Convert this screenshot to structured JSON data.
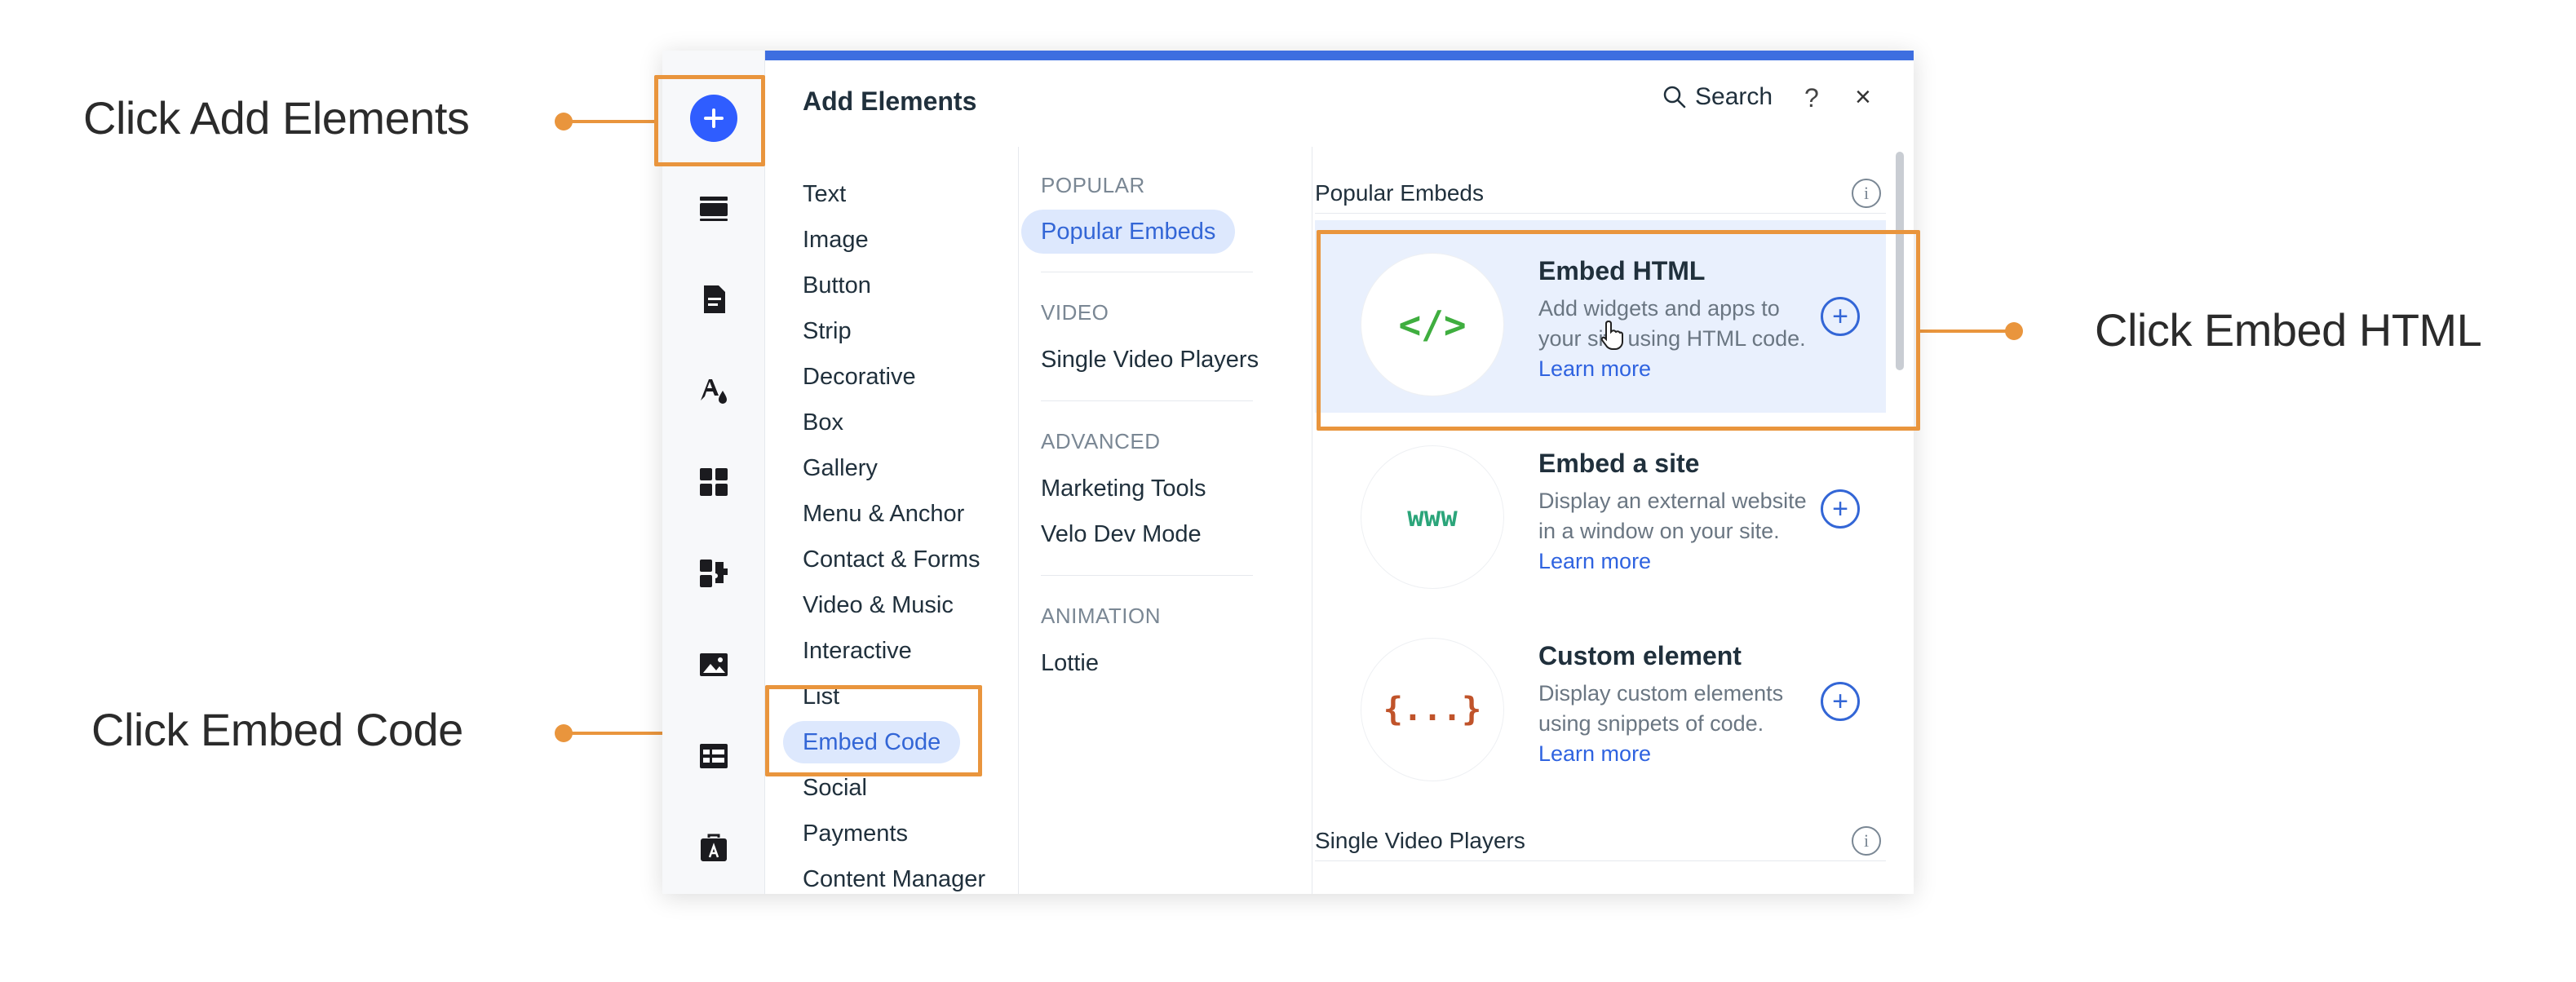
{
  "annotations": {
    "add_elements": "Click Add Elements",
    "embed_html": "Click Embed HTML",
    "embed_code": "Click Embed Code"
  },
  "panel": {
    "title": "Add Elements",
    "search_label": "Search",
    "help_label": "?",
    "close_label": "×"
  },
  "categories": [
    "Text",
    "Image",
    "Button",
    "Strip",
    "Decorative",
    "Box",
    "Gallery",
    "Menu & Anchor",
    "Contact & Forms",
    "Video & Music",
    "Interactive",
    "List",
    "Embed Code",
    "Social",
    "Payments",
    "Content Manager"
  ],
  "selected_category": "Embed Code",
  "subcategories": {
    "popular_label": "POPULAR",
    "popular_item": "Popular Embeds",
    "video_label": "VIDEO",
    "video_item": "Single Video Players",
    "advanced_label": "ADVANCED",
    "advanced_items": [
      "Marketing Tools",
      "Velo Dev Mode"
    ],
    "animation_label": "ANIMATION",
    "animation_item": "Lottie"
  },
  "content": {
    "section1_title": "Popular Embeds",
    "section2_title": "Single Video Players",
    "info_glyph": "i",
    "add_glyph": "+",
    "cards": [
      {
        "thumb": "</>",
        "title": "Embed HTML",
        "desc": "Add widgets and apps to your site using HTML code.",
        "link": "Learn more",
        "thumb_color": "#3fae3f"
      },
      {
        "thumb": "www",
        "title": "Embed a site",
        "desc": "Display an external website in a window on your site.",
        "link": "Learn more",
        "thumb_color": "#2ba57a"
      },
      {
        "thumb": "{...}",
        "title": "Custom element",
        "desc": "Display custom elements using snippets of code.",
        "link": "Learn more",
        "thumb_color": "#c0532a"
      }
    ]
  },
  "colors": {
    "accent": "#3366d6",
    "highlight": "#e9953d",
    "topbar": "#3d6ee0"
  },
  "rail_icons": [
    "add-icon",
    "strip-icon",
    "page-icon",
    "theme-icon",
    "apps-icon",
    "plugins-icon",
    "media-icon",
    "table-icon",
    "briefcase-icon"
  ]
}
